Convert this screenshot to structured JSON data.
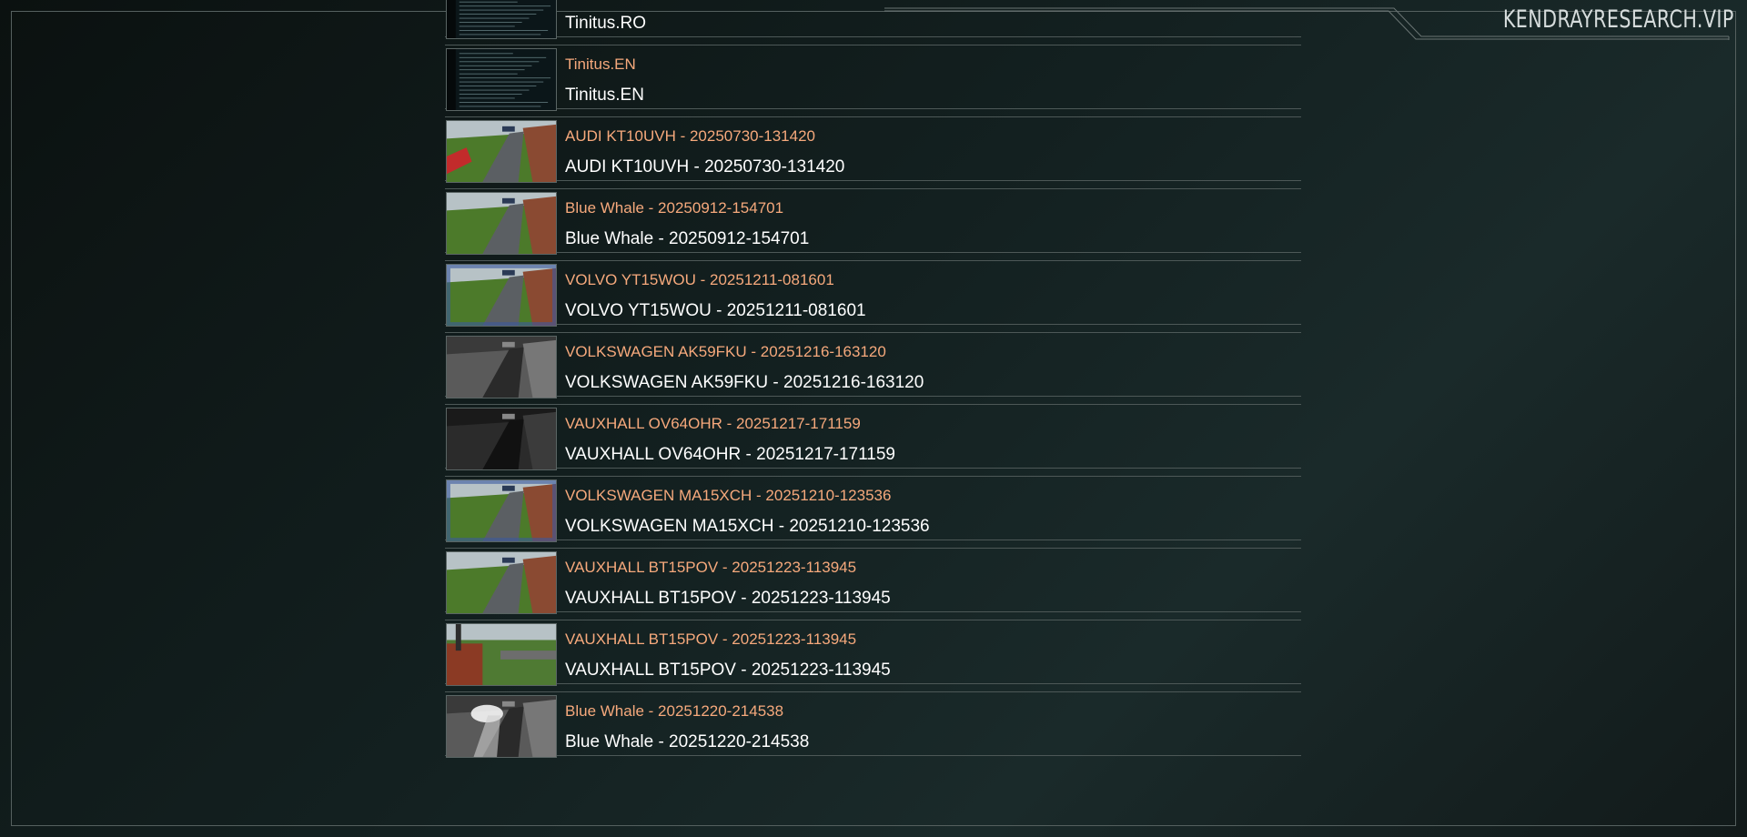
{
  "brand": {
    "text": "KENDRAYRESEARCH.VIP"
  },
  "items": [
    {
      "title": "Tinitus.RO",
      "subtitle": "Tinitus.RO",
      "thumb": "document-thumbnail"
    },
    {
      "title": "Tinitus.EN",
      "subtitle": "Tinitus.EN",
      "thumb": "document-thumbnail"
    },
    {
      "title": "AUDI KT10UVH - 20250730-131420",
      "subtitle": "AUDI KT10UVH - 20250730-131420",
      "thumb": "camera-color-red-car"
    },
    {
      "title": "Blue Whale - 20250912-154701",
      "subtitle": "Blue Whale - 20250912-154701",
      "thumb": "camera-color"
    },
    {
      "title": "VOLVO YT15WOU - 20251211-081601",
      "subtitle": "VOLVO YT15WOU - 20251211-081601",
      "thumb": "camera-fisheye-color"
    },
    {
      "title": "VOLKSWAGEN AK59FKU - 20251216-163120",
      "subtitle": "VOLKSWAGEN AK59FKU - 20251216-163120",
      "thumb": "camera-night"
    },
    {
      "title": "VAUXHALL OV64OHR - 20251217-171159",
      "subtitle": "VAUXHALL OV64OHR - 20251217-171159",
      "thumb": "camera-night-dark"
    },
    {
      "title": "VOLKSWAGEN MA15XCH - 20251210-123536",
      "subtitle": "VOLKSWAGEN MA15XCH - 20251210-123536",
      "thumb": "camera-fisheye-color"
    },
    {
      "title": "VAUXHALL BT15POV - 20251223-113945",
      "subtitle": "VAUXHALL BT15POV - 20251223-113945",
      "thumb": "camera-color"
    },
    {
      "title": "VAUXHALL BT15POV - 20251223-113945",
      "subtitle": "VAUXHALL BT15POV - 20251223-113945",
      "thumb": "camera-street-color"
    },
    {
      "title": "Blue Whale - 20251220-214538",
      "subtitle": "Blue Whale - 20251220-214538",
      "thumb": "camera-night-light"
    }
  ]
}
